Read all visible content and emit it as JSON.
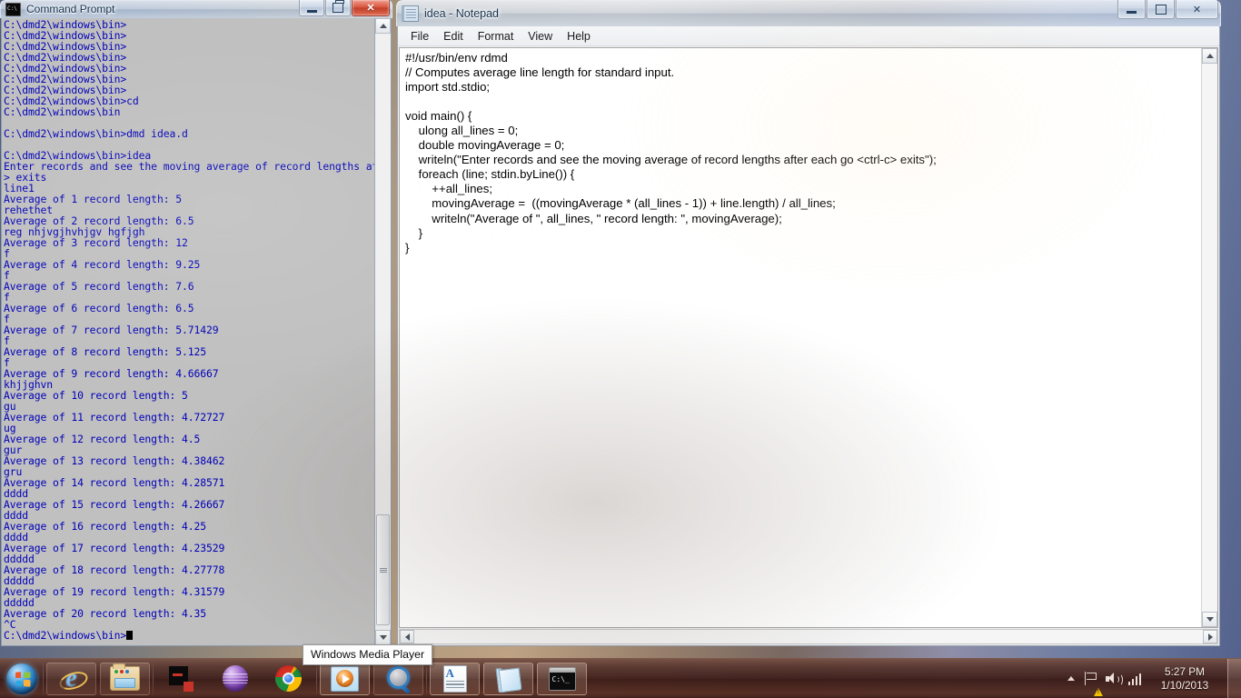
{
  "cmd_window": {
    "title": "Command Prompt",
    "icon": "cmd-icon",
    "buttons": {
      "minimize": "minimize",
      "restore": "restore",
      "close": "close"
    },
    "console_output": "C:\\dmd2\\windows\\bin>\nC:\\dmd2\\windows\\bin>\nC:\\dmd2\\windows\\bin>\nC:\\dmd2\\windows\\bin>\nC:\\dmd2\\windows\\bin>\nC:\\dmd2\\windows\\bin>\nC:\\dmd2\\windows\\bin>\nC:\\dmd2\\windows\\bin>cd\nC:\\dmd2\\windows\\bin\n\nC:\\dmd2\\windows\\bin>dmd idea.d\n\nC:\\dmd2\\windows\\bin>idea\nEnter records and see the moving average of record lengths after each go <ctrl-c\n> exits\nline1\nAverage of 1 record length: 5\nrehethet\nAverage of 2 record length: 6.5\nreg nhjvgjhvhjgv hgfjgh\nAverage of 3 record length: 12\nf\nAverage of 4 record length: 9.25\nf\nAverage of 5 record length: 7.6\nf\nAverage of 6 record length: 6.5\nf\nAverage of 7 record length: 5.71429\nf\nAverage of 8 record length: 5.125\nf\nAverage of 9 record length: 4.66667\nkhjjghvn\nAverage of 10 record length: 5\ngu\nAverage of 11 record length: 4.72727\nug\nAverage of 12 record length: 4.5\ngur\nAverage of 13 record length: 4.38462\ngru\nAverage of 14 record length: 4.28571\ndddd\nAverage of 15 record length: 4.26667\ndddd\nAverage of 16 record length: 4.25\ndddd\nAverage of 17 record length: 4.23529\nddddd\nAverage of 18 record length: 4.27778\nddddd\nAverage of 19 record length: 4.31579\nddddd\nAverage of 20 record length: 4.35\n^C\nC:\\dmd2\\windows\\bin>",
    "colors": {
      "text": "#0000b8",
      "background": "#c0c0c0"
    }
  },
  "notepad_window": {
    "title": "idea - Notepad",
    "icon": "notepad-icon",
    "buttons": {
      "minimize": "minimize",
      "maximize": "maximize",
      "close": "close"
    },
    "menus": [
      "File",
      "Edit",
      "Format",
      "View",
      "Help"
    ],
    "document_text": "#!/usr/bin/env rdmd\n// Computes average line length for standard input.\nimport std.stdio;\n\nvoid main() {\n    ulong all_lines = 0;\n    double movingAverage = 0;\n    writeln(\"Enter records and see the moving average of record lengths after each go <ctrl-c> exits\");\n    foreach (line; stdin.byLine()) {\n        ++all_lines;\n        movingAverage =  ((movingAverage * (all_lines - 1)) + line.length) / all_lines;\n        writeln(\"Average of \", all_lines, \" record length: \", movingAverage);\n    }\n}"
  },
  "tooltip": {
    "text": "Windows Media Player"
  },
  "taskbar": {
    "start_label": "Start",
    "items": [
      {
        "name": "internet-explorer",
        "label": "Internet Explorer",
        "pinned": true,
        "running": false
      },
      {
        "name": "windows-explorer",
        "label": "Windows Explorer",
        "pinned": true,
        "running": false
      },
      {
        "name": "black-red-app",
        "label": "Application",
        "pinned": false,
        "running": false
      },
      {
        "name": "opera",
        "label": "Opera",
        "pinned": false,
        "running": false
      },
      {
        "name": "google-chrome",
        "label": "Google Chrome",
        "pinned": false,
        "running": false
      },
      {
        "name": "windows-media-player",
        "label": "Windows Media Player",
        "pinned": true,
        "running": true
      },
      {
        "name": "search",
        "label": "Search",
        "pinned": true,
        "running": false
      },
      {
        "name": "wordpad",
        "label": "WordPad",
        "pinned": true,
        "running": true
      },
      {
        "name": "notepad",
        "label": "Notepad",
        "pinned": true,
        "running": true
      },
      {
        "name": "command-prompt",
        "label": "Command Prompt",
        "pinned": true,
        "running": true
      }
    ],
    "tray": {
      "show_hidden_icons": "Show hidden icons",
      "network_status": "Network — no Internet access",
      "volume": "Volume",
      "signal": "Signal strength",
      "time": "5:27 PM",
      "date": "1/10/2013",
      "show_desktop": "Show desktop"
    }
  }
}
